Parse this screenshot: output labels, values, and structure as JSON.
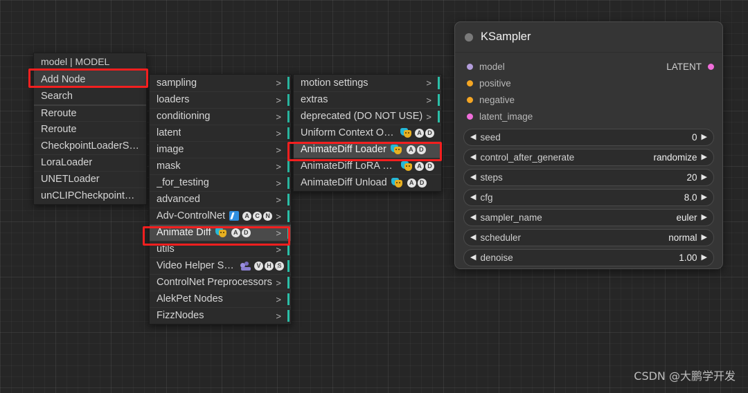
{
  "app": {
    "background": "#262626",
    "highlight_color": "#f31f1f",
    "watermark": "CSDN @大鹏学开发"
  },
  "context_menu": {
    "title": "model | MODEL",
    "items": [
      {
        "label": "Add Node",
        "highlighted": true,
        "separator_after": false
      },
      {
        "label": "Search",
        "highlighted": false,
        "separator_after": true
      },
      {
        "label": "Reroute",
        "highlighted": false
      },
      {
        "label": "Reroute",
        "highlighted": false
      },
      {
        "label": "CheckpointLoaderSimple",
        "highlighted": false
      },
      {
        "label": "LoraLoader",
        "highlighted": false
      },
      {
        "label": "UNETLoader",
        "highlighted": false
      },
      {
        "label": "unCLIPCheckpointLoader",
        "highlighted": false
      }
    ]
  },
  "category_menu": {
    "items": [
      {
        "label": "sampling",
        "arrow": ">",
        "icons": []
      },
      {
        "label": "loaders",
        "arrow": ">",
        "icons": []
      },
      {
        "label": "conditioning",
        "arrow": ">",
        "icons": []
      },
      {
        "label": "latent",
        "arrow": ">",
        "icons": []
      },
      {
        "label": "image",
        "arrow": ">",
        "icons": []
      },
      {
        "label": "mask",
        "arrow": ">",
        "icons": []
      },
      {
        "label": "_for_testing",
        "arrow": ">",
        "icons": []
      },
      {
        "label": "advanced",
        "arrow": ">",
        "icons": []
      },
      {
        "label": "Adv-ControlNet",
        "arrow": ">",
        "icons": [
          "controlnet-icon"
        ],
        "badges": [
          "A",
          "C",
          "N"
        ]
      },
      {
        "label": "Animate Diff",
        "arrow": ">",
        "icons": [
          "masks-icon"
        ],
        "badges": [
          "A",
          "D"
        ],
        "highlighted": true
      },
      {
        "label": "utils",
        "arrow": ">",
        "icons": []
      },
      {
        "label": "Video Helper Suite",
        "arrow": ">",
        "icons": [
          "vhs-icon"
        ],
        "badges": [
          "V",
          "H",
          "S"
        ]
      },
      {
        "label": "ControlNet Preprocessors",
        "arrow": ">",
        "icons": []
      },
      {
        "label": "AlekPet Nodes",
        "arrow": ">",
        "icons": []
      },
      {
        "label": "FizzNodes",
        "arrow": ">",
        "icons": []
      }
    ]
  },
  "animatediff_menu": {
    "items": [
      {
        "label": "motion settings",
        "arrow": ">",
        "badges": []
      },
      {
        "label": "extras",
        "arrow": ">",
        "badges": []
      },
      {
        "label": "deprecated (DO NOT USE)",
        "arrow": ">",
        "badges": []
      },
      {
        "label": "Uniform Context Options",
        "arrow": "",
        "icons": [
          "masks-icon"
        ],
        "badges": [
          "A",
          "D"
        ]
      },
      {
        "label": "AnimateDiff Loader",
        "arrow": "",
        "icons": [
          "masks-icon"
        ],
        "badges": [
          "A",
          "D"
        ],
        "highlighted": true
      },
      {
        "label": "AnimateDiff LoRA Loader",
        "arrow": "",
        "icons": [
          "masks-icon"
        ],
        "badges": [
          "A",
          "D"
        ]
      },
      {
        "label": "AnimateDiff Unload",
        "arrow": "",
        "icons": [
          "masks-icon"
        ],
        "badges": [
          "A",
          "D"
        ]
      }
    ]
  },
  "ksampler": {
    "title": "KSampler",
    "inputs": [
      {
        "label": "model",
        "color": "#b39ddb"
      },
      {
        "label": "positive",
        "color": "#f5a623"
      },
      {
        "label": "negative",
        "color": "#f5a623"
      },
      {
        "label": "latent_image",
        "color": "#f06eda"
      }
    ],
    "outputs": [
      {
        "label": "LATENT",
        "color": "#f06eda"
      }
    ],
    "widgets": [
      {
        "name": "seed",
        "value": "0"
      },
      {
        "name": "control_after_generate",
        "value": "randomize"
      },
      {
        "name": "steps",
        "value": "20"
      },
      {
        "name": "cfg",
        "value": "8.0"
      },
      {
        "name": "sampler_name",
        "value": "euler"
      },
      {
        "name": "scheduler",
        "value": "normal"
      },
      {
        "name": "denoise",
        "value": "1.00"
      }
    ],
    "arrow_left": "◀",
    "arrow_right": "▶"
  }
}
